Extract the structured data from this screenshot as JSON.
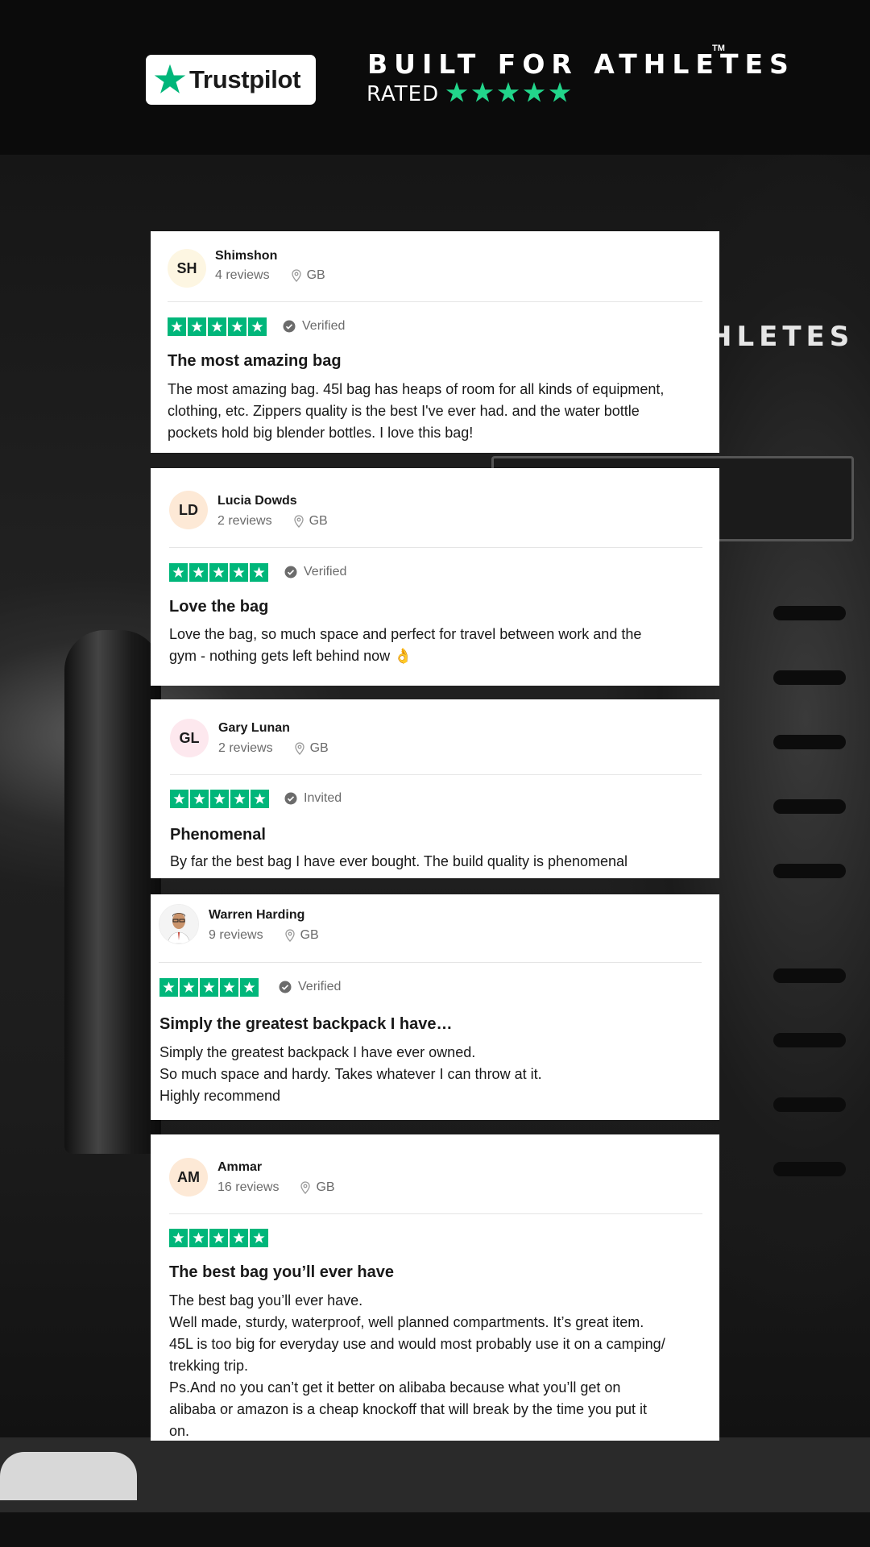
{
  "header": {
    "trustpilot_label": "Trustpilot",
    "brand_line": "BUILT FOR ATHLETES",
    "trademark": "TM",
    "rated_label": "RATED",
    "rated_stars": 5,
    "background_brand_text": "HLETES"
  },
  "colors": {
    "trustpilot_green": "#00b67a",
    "rated_star": "#22d68b",
    "card_bg": "#ffffff"
  },
  "reviews": [
    {
      "initials": "SH",
      "avatar_color": "#fdf6e2",
      "name": "Shimshon",
      "review_count": "4 reviews",
      "country": "GB",
      "stars": 5,
      "badge": "Verified",
      "title": "The most amazing bag",
      "body": "The most amazing bag. 45l bag has heaps of room for all kinds of equipment,\nclothing, etc. Zippers quality is the best I've ever had. and the water bottle\npockets hold big blender bottles. I love this bag!"
    },
    {
      "initials": "LD",
      "avatar_color": "#fde9d6",
      "name": "Lucia Dowds",
      "review_count": "2 reviews",
      "country": "GB",
      "stars": 5,
      "badge": "Verified",
      "title": "Love the bag",
      "body": "Love the bag, so much space and perfect for travel between work and the\ngym - nothing gets left behind now 👌"
    },
    {
      "initials": "GL",
      "avatar_color": "#fde8ee",
      "name": "Gary Lunan",
      "review_count": "2 reviews",
      "country": "GB",
      "stars": 5,
      "badge": "Invited",
      "title": "Phenomenal",
      "body": "By far the best bag I have ever bought. The build quality is phenomenal"
    },
    {
      "initials": "",
      "avatar_color": "#ffffff",
      "name": "Warren Harding",
      "review_count": "9 reviews",
      "country": "GB",
      "stars": 5,
      "badge": "Verified",
      "title": "Simply the greatest backpack I have…",
      "body": "Simply the greatest backpack I have ever owned.\nSo much space and hardy. Takes whatever I can throw at it.\nHighly recommend"
    },
    {
      "initials": "AM",
      "avatar_color": "#fde9d6",
      "name": "Ammar",
      "review_count": "16 reviews",
      "country": "GB",
      "stars": 5,
      "badge": "",
      "title": "The best bag you’ll ever have",
      "body": "The best bag you’ll ever have.\nWell made, sturdy, waterproof, well planned compartments. It’s great item.\n45L is too big for everyday use and would most probably use it on a camping/\ntrekking trip.\nPs.And no you can’t get it better on alibaba because what you’ll get on\nalibaba or amazon is a cheap knockoff that will break by the time you put it\non."
    }
  ]
}
